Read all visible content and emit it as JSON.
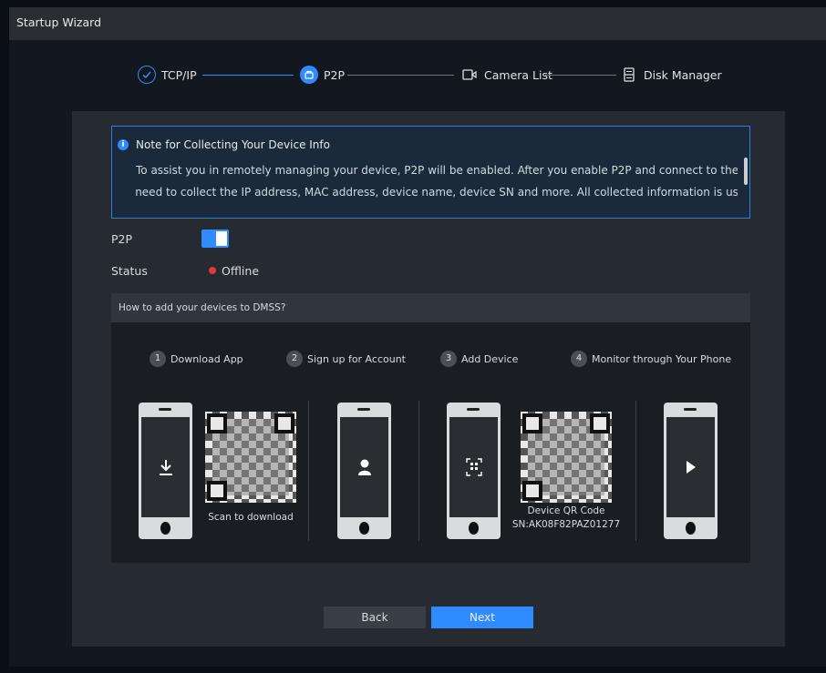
{
  "window": {
    "title": "Startup Wizard"
  },
  "steps": [
    {
      "label": "TCP/IP",
      "icon": "check-circle-icon",
      "state": "done"
    },
    {
      "label": "P2P",
      "icon": "p2p-icon",
      "state": "active"
    },
    {
      "label": "Camera List",
      "icon": "camera-icon",
      "state": "pending"
    },
    {
      "label": "Disk Manager",
      "icon": "disk-icon",
      "state": "pending"
    }
  ],
  "note": {
    "title": "Note for Collecting Your Device Info",
    "line1": "To assist you in remotely managing your device, P2P will be enabled. After you enable P2P and connect to the Internet, w",
    "line2": "e need to collect the IP address, MAC address, device name, device SN and more. All collected information is used only fo"
  },
  "p2p": {
    "label": "P2P",
    "enabled": true
  },
  "status": {
    "label": "Status",
    "value": "Offline",
    "color": "#e8343d"
  },
  "howto": {
    "header": "How to add your devices to DMSS?",
    "steps": [
      {
        "num": "1",
        "text": "Download App"
      },
      {
        "num": "2",
        "text": "Sign up for Account"
      },
      {
        "num": "3",
        "text": "Add Device"
      },
      {
        "num": "4",
        "text": "Monitor through Your Phone"
      }
    ],
    "scan_caption": "Scan to download",
    "device_qr_caption": "Device QR Code",
    "device_sn": "SN:AK08F82PAZ01277"
  },
  "buttons": {
    "back": "Back",
    "next": "Next"
  },
  "colors": {
    "accent": "#2f8bff",
    "offline": "#e8343d"
  }
}
